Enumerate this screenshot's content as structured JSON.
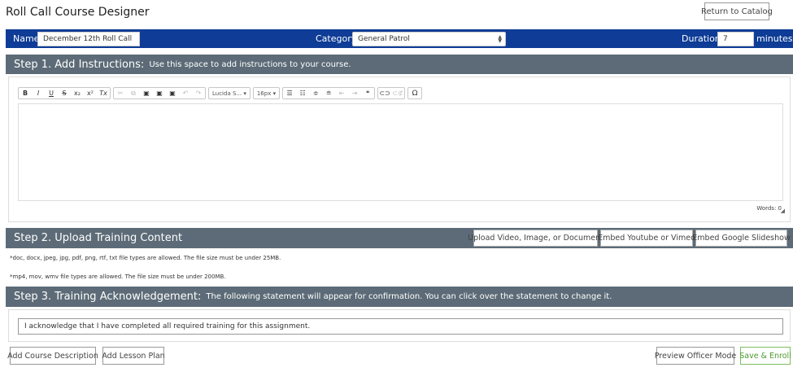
{
  "app": {
    "title": "Roll Call Course Designer",
    "return_label": "Return to Catalog"
  },
  "course": {
    "name_label": "Name",
    "name_value": "December 12th Roll Call",
    "category_label": "Category",
    "category_value": "General Patrol",
    "duration_label": "Duration",
    "duration_value": "7",
    "duration_unit": "minutes"
  },
  "step1": {
    "title": "Step 1. Add Instructions:",
    "desc": "Use this space to add instructions to your course.",
    "toolbar": {
      "font_family": "Lucida S...",
      "font_size": "16px",
      "buttons": [
        "B",
        "I",
        "U",
        "S",
        "x₂",
        "x²",
        "Tx"
      ]
    },
    "word_count": "Words: 0"
  },
  "step2": {
    "title": "Step 2. Upload Training Content",
    "upload_label": "Upload Video, Image, or Document",
    "youtube_label": "Embed Youtube or Vimeo",
    "slideshow_label": "Embed Google Slideshow",
    "note_docs": "*doc, docx, jpeg, jpg, pdf, png, rtf, txt file types are allowed. The file size must be under 25MB.",
    "note_video": "*mp4, mov, wmv file types are allowed. The file size must be under 200MB."
  },
  "step3": {
    "title": "Step 3. Training Acknowledgement:",
    "desc": "The following statement will appear for confirmation. You can click over the statement to change it.",
    "statement": "I acknowledge that I have completed all required training for this assignment."
  },
  "footer": {
    "add_description": "Add Course Description",
    "add_lesson_plan": "Add Lesson Plan",
    "preview": "Preview Officer Mode",
    "save": "Save & Enroll"
  },
  "colors": {
    "header_blue": "#0e3c96",
    "section_gray": "#5c6b77",
    "save_green": "#4a9a2e"
  }
}
